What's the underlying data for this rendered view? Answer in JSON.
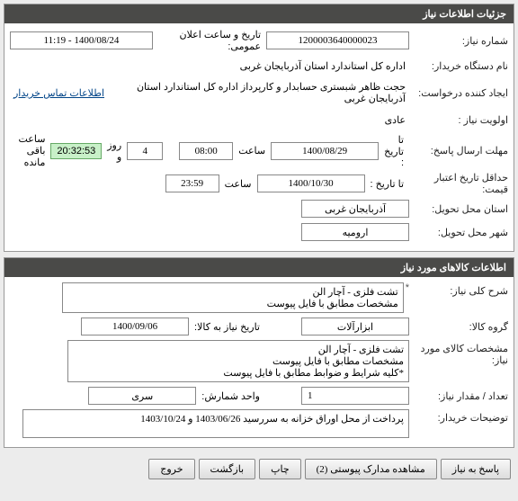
{
  "panels": {
    "need_info_title": "جزئیات اطلاعات نیاز",
    "goods_info_title": "اطلاعات کالاهای مورد نیاز"
  },
  "need": {
    "number_label": "شماره نیاز:",
    "number_value": "1200003640000023",
    "public_announce_label": "تاریخ و ساعت اعلان عمومی:",
    "public_announce_value": "1400/08/24 - 11:19",
    "buyer_label": "نام دستگاه خریدار:",
    "buyer_value": "اداره کل استاندارد استان آذربایجان غربی",
    "creator_label": "ایجاد کننده درخواست:",
    "creator_value": "حجت ظاهر شبستری حسابدار و کارپرداز اداره کل استاندارد استان آذربایجان غربی",
    "contact_link": "اطلاعات تماس خریدار",
    "priority_label": "اولویت نیاز :",
    "priority_value": "عادی",
    "deadline_label": "مهلت ارسال پاسخ:",
    "deadline_to_label": "تا تاریخ :",
    "deadline_date": "1400/08/29",
    "time_label": "ساعت",
    "deadline_time": "08:00",
    "days_value": "4",
    "days_text": "روز و",
    "countdown": "20:32:53",
    "remaining_text": "ساعت باقی مانده",
    "price_validity_label": "حداقل تاریخ اعتبار قیمت:",
    "price_validity_to": "تا تاریخ :",
    "price_validity_date": "1400/10/30",
    "price_validity_time": "23:59",
    "delivery_province_label": "استان محل تحویل:",
    "delivery_province": "آذربایجان غربی",
    "delivery_city_label": "شهر محل تحویل:",
    "delivery_city": "ارومیه"
  },
  "goods": {
    "general_desc_label": "شرح کلی نیاز:",
    "general_desc": "تشت فلزی - آچار الن\nمشخصات مطابق با فایل پیوست",
    "group_label": "گروه کالا:",
    "group_value": "ابزارآلات",
    "need_date_label": "تاریخ نیاز به کالا:",
    "need_date": "1400/09/06",
    "spec_label": "مشخصات کالای مورد نیاز:",
    "spec_value": "تشت فلزی - آچار الن\nمشخصات مطابق با فایل پیوست\n*کلیه شرایط و ضوابط مطابق با فایل پیوست",
    "qty_label": "تعداد / مقدار نیاز:",
    "qty_value": "1",
    "unit_label": "واحد شمارش:",
    "unit_value": "سری",
    "buyer_notes_label": "توضیحات خریدار:",
    "buyer_notes": "پرداخت از محل اوراق خزانه به سررسید 1403/06/26 و 1403/10/24"
  },
  "footer": {
    "respond": "پاسخ به نیاز",
    "attachments": "مشاهده مدارک پیوستی",
    "attachments_count": "(2)",
    "print": "چاپ",
    "back": "بازگشت",
    "exit": "خروج"
  }
}
